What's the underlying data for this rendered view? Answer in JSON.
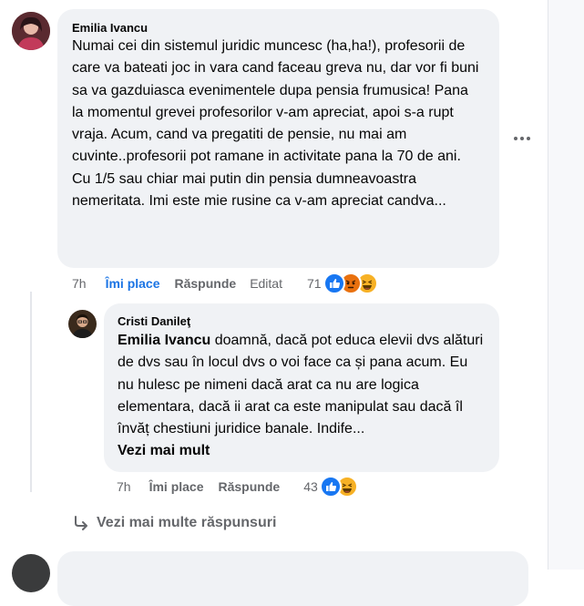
{
  "comment": {
    "author": "Emilia Ivancu",
    "text": "Numai cei din sistemul juridic muncesc (ha,ha!), profesorii de care va bateati joc in vara cand faceau greva nu, dar vor fi buni sa va gazduiasca evenimentele dupa pensia frumusica! Pana la momentul grevei profesorilor v-am apreciat, apoi s-a rupt vraja. Acum, cand va pregatiti de pensie, nu mai am cuvinte..profesorii pot ramane in activitate pana la 70 de ani. Cu 1/5 sau chiar mai putin din pensia dumneavoastra nemeritata. Imi este mie rusine ca v-am apreciat candva...",
    "time": "7h",
    "like_label": "Îmi place",
    "reply_label": "Răspunde",
    "edited_label": "Editat",
    "reaction_count": "71",
    "reactions": [
      "like-icon",
      "angry-icon",
      "haha-icon"
    ]
  },
  "reply": {
    "author": "Cristi Danileţ",
    "mention": "Emilia Ivancu",
    "text": " doamnă, dacă pot educa elevii dvs alături de dvs sau în locul dvs o voi face ca și pana acum. Eu nu hulesc pe nimeni dacă arat ca nu are logica elementara, dacă ii arat ca este manipulat sau dacă îl învăț chestiuni juridice banale. Indife...",
    "see_more": "Vezi mai mult",
    "time": "7h",
    "like_label": "Îmi place",
    "reply_label": "Răspunde",
    "reaction_count": "43",
    "reactions": [
      "like-icon",
      "haha-icon"
    ]
  },
  "more_replies_label": "Vezi mai multe răspunsuri",
  "colors": {
    "bubble_bg": "#f0f2f5",
    "link_blue": "#1b74e4",
    "meta_gray": "#65676b",
    "like_blue": "#1877f2",
    "angry_orange": "#e9710f",
    "haha_yellow": "#f7b125"
  }
}
